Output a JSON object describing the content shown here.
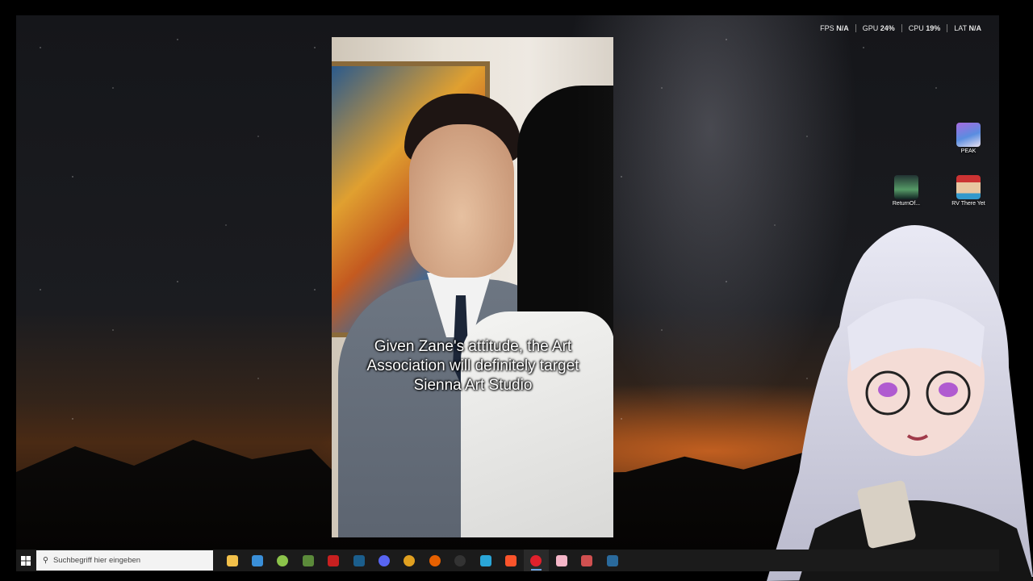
{
  "performance_overlay": {
    "fps_label": "FPS",
    "fps_value": "N/A",
    "gpu_label": "GPU",
    "gpu_value": "24%",
    "cpu_label": "CPU",
    "cpu_value": "19%",
    "lat_label": "LAT",
    "lat_value": "N/A"
  },
  "desktop_icons": [
    {
      "label": "PEAK",
      "icon": "peak-game-icon"
    },
    {
      "label": "ReturnOf...",
      "icon": "return-game-icon"
    },
    {
      "label": "RV There Yet",
      "icon": "rv-there-yet-game-icon"
    }
  ],
  "video": {
    "subtitle": "Given Zane's attitude, the Art Association will definitely target Sienna Art Studio"
  },
  "taskbar": {
    "search_placeholder": "Suchbegriff hier eingeben",
    "apps": [
      {
        "name": "file-explorer",
        "color": "#f2c04a",
        "glyph": ""
      },
      {
        "name": "microsoft-store",
        "color": "#3a8fd8",
        "glyph": ""
      },
      {
        "name": "android-app",
        "color": "#8bc34a",
        "glyph": ""
      },
      {
        "name": "minecraft",
        "color": "#5b8a3a",
        "glyph": ""
      },
      {
        "name": "game-app",
        "color": "#c82020",
        "glyph": ""
      },
      {
        "name": "steam",
        "color": "#1b5e8c",
        "glyph": ""
      },
      {
        "name": "discord",
        "color": "#5865f2",
        "glyph": ""
      },
      {
        "name": "chrome",
        "color": "#e0a020",
        "glyph": ""
      },
      {
        "name": "firefox",
        "color": "#e66000",
        "glyph": ""
      },
      {
        "name": "obs-studio",
        "color": "#333333",
        "glyph": ""
      },
      {
        "name": "edge",
        "color": "#2aa6d8",
        "glyph": ""
      },
      {
        "name": "brave",
        "color": "#fb542b",
        "glyph": ""
      },
      {
        "name": "opera",
        "color": "#e0202c",
        "glyph": "",
        "active": true
      },
      {
        "name": "pink-app",
        "color": "#f5b6c8",
        "glyph": ""
      },
      {
        "name": "tool-app",
        "color": "#d05050",
        "glyph": ""
      },
      {
        "name": "steam-2",
        "color": "#2a6a9c",
        "glyph": ""
      }
    ]
  }
}
